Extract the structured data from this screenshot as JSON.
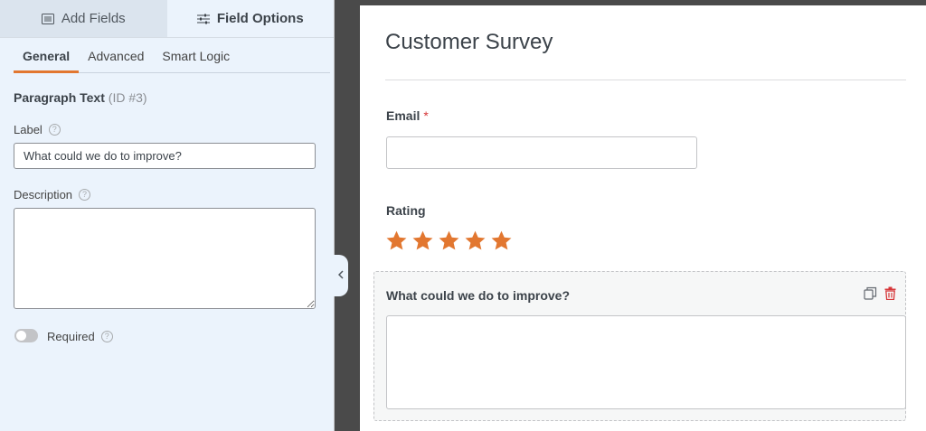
{
  "tabs": {
    "add_fields": "Add Fields",
    "field_options": "Field Options"
  },
  "sub_tabs": [
    "General",
    "Advanced",
    "Smart Logic"
  ],
  "field": {
    "type_label": "Paragraph Text",
    "id_label": "(ID #3)"
  },
  "options": {
    "label_title": "Label",
    "label_value": "What could we do to improve?",
    "description_title": "Description",
    "description_value": "",
    "required_label": "Required",
    "required_on": false,
    "help_glyph": "?"
  },
  "preview": {
    "title": "Customer Survey",
    "email_label": "Email",
    "required_mark": "*",
    "rating_label": "Rating",
    "rating_stars": 5,
    "improve_label": "What could we do to improve?"
  },
  "colors": {
    "accent": "#e27730",
    "star": "#e27730",
    "delete": "#d63638",
    "panel": "#ebf3fc"
  },
  "icons": {
    "add_fields": "list-icon",
    "field_options": "sliders-icon",
    "duplicate": "duplicate-icon",
    "delete": "trash-icon",
    "collapse": "chevron-left-icon"
  }
}
